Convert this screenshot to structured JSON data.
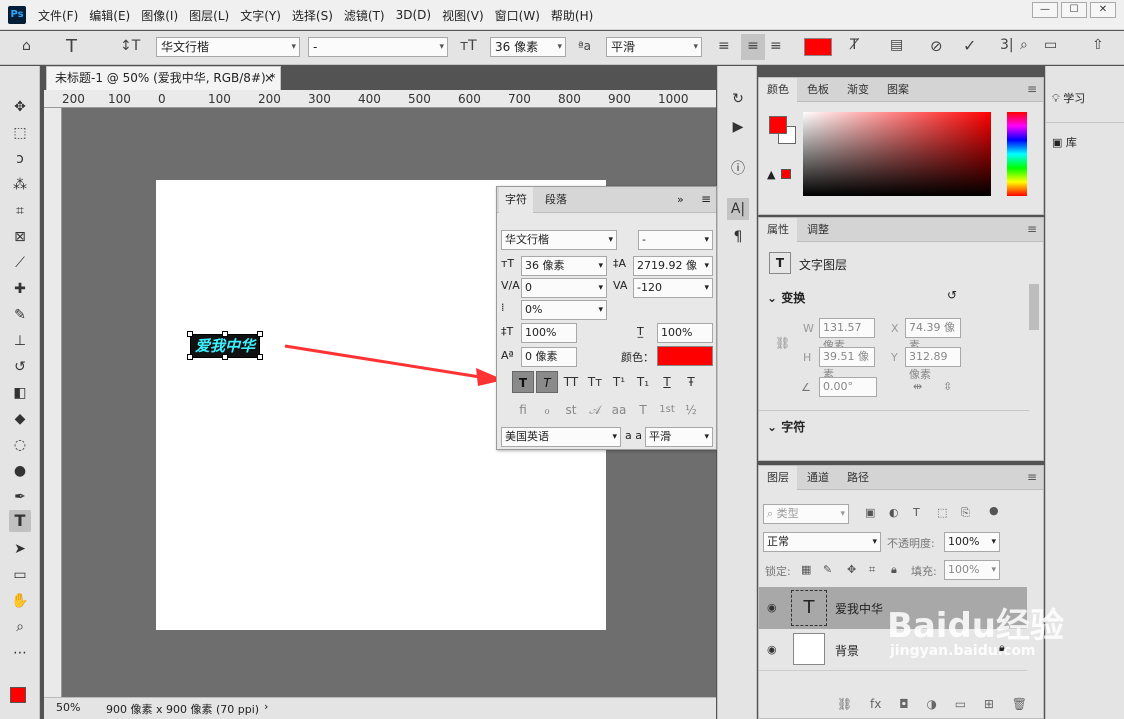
{
  "app": {
    "logo": "Ps"
  },
  "menu": [
    "文件(F)",
    "编辑(E)",
    "图像(I)",
    "图层(L)",
    "文字(Y)",
    "选择(S)",
    "滤镜(T)",
    "3D(D)",
    "视图(V)",
    "窗口(W)",
    "帮助(H)"
  ],
  "options": {
    "font_family": "华文行楷",
    "font_style": "-",
    "font_size": "36 像素",
    "antialias": "平滑",
    "color": "#ff0000"
  },
  "document": {
    "tab_title": "未标题-1 @ 50% (爱我中华, RGB/8#) *",
    "ruler_ticks": [
      "200",
      "100",
      "0",
      "100",
      "200",
      "300",
      "400",
      "500",
      "600",
      "700",
      "800",
      "900",
      "1000"
    ],
    "canvas_text": "爱我中华",
    "zoom": "50%",
    "doc_info": "900 像素 x 900 像素 (70 ppi)"
  },
  "character_panel": {
    "tab_char": "字符",
    "tab_para": "段落",
    "font_family": "华文行楷",
    "font_style": "-",
    "font_size": "36 像素",
    "leading": "2719.92 像",
    "kerning": "0",
    "tracking": "-120",
    "scale_pct": "0%",
    "vscale": "100%",
    "hscale": "100%",
    "baseline": "0 像素",
    "color_label": "颜色：",
    "color": "#ff0000",
    "style_buttons": [
      "T",
      "T",
      "TT",
      "Tт",
      "T¹",
      "T₁",
      "T",
      "Ŧ"
    ],
    "opentype_buttons": [
      "fi",
      "ℴ",
      "st",
      "𝒜",
      "aa",
      "T",
      "1st",
      "½"
    ],
    "language": "美国英语",
    "aa_label": "a a",
    "antialias": "平滑"
  },
  "color_panel": {
    "tabs": [
      "颜色",
      "色板",
      "渐变",
      "图案"
    ],
    "fg_color": "#ff0000",
    "bg_color": "#ffffff"
  },
  "properties_panel": {
    "tabs": [
      "属性",
      "调整"
    ],
    "layer_type": "文字图层",
    "section_transform": "变换",
    "w_label": "W",
    "w_value": "131.57 像素",
    "x_label": "X",
    "x_value": "74.39 像素",
    "h_label": "H",
    "h_value": "39.51 像素",
    "y_label": "Y",
    "y_value": "312.89 像素",
    "angle": "0.00°",
    "section_char": "字符"
  },
  "layers_panel": {
    "tabs": [
      "图层",
      "通道",
      "路径"
    ],
    "filter_kind": "类型",
    "blend_mode": "正常",
    "opacity_label": "不透明度:",
    "opacity": "100%",
    "lock_label": "锁定:",
    "fill_label": "填充:",
    "fill": "100%",
    "layers": [
      {
        "name": "爱我中华",
        "type": "text"
      },
      {
        "name": "背景",
        "type": "background"
      }
    ]
  },
  "far_right": {
    "learn": "学习",
    "library": "库"
  },
  "watermark": "Baidu经验",
  "watermark_url": "jingyan.baidu.com"
}
